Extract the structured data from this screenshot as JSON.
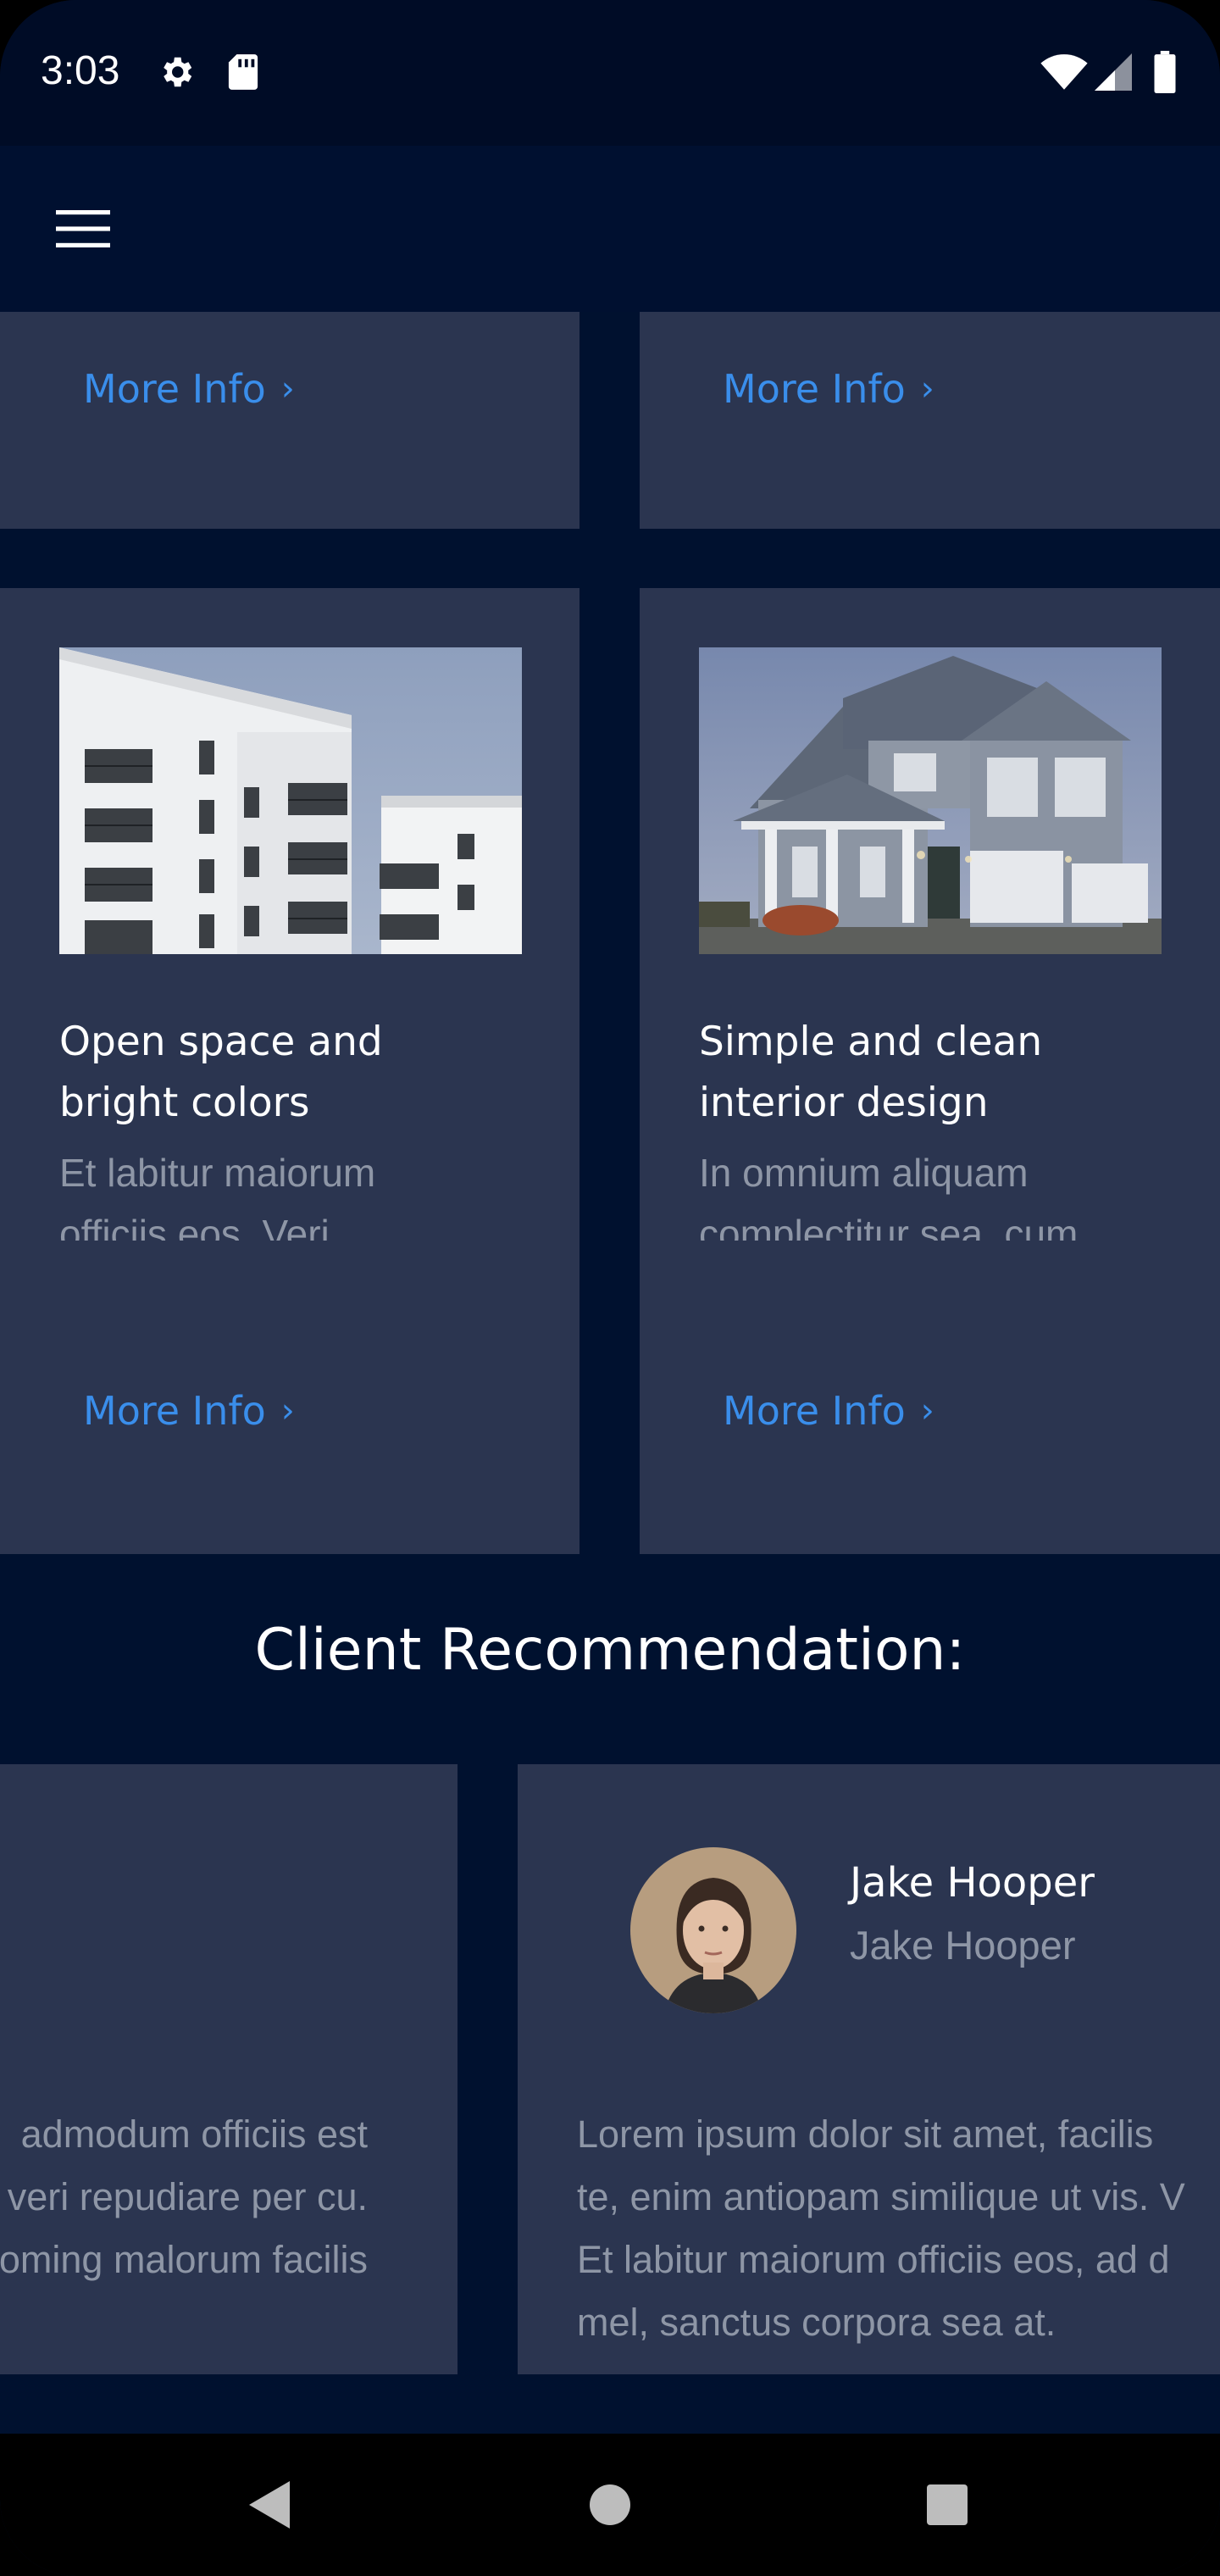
{
  "status_bar": {
    "time": "3:03",
    "icons": [
      "settings-icon",
      "sd-card-icon",
      "wifi-icon",
      "cellular-signal-icon",
      "battery-icon"
    ]
  },
  "toolbar": {
    "menu_icon": "hamburger-menu-icon"
  },
  "colors": {
    "background": "#00112f",
    "card": "#2b3550",
    "link": "#3a8eeb",
    "muted_text": "#8e96a6",
    "status_bar": "#000c26"
  },
  "property_cards_top": [
    {
      "link": "More Info"
    },
    {
      "link": "More Info"
    }
  ],
  "property_cards": [
    {
      "title_line1": "Open space and",
      "title_line2": "bright colors",
      "text_line1": "Et labitur maiorum",
      "text_line2": "officiis eos. Veri",
      "link": "More Info"
    },
    {
      "title_line1": "Simple and clean",
      "title_line2": "interior design",
      "text_line1": "In omnium aliquam",
      "text_line2": "complectitur sea, cum",
      "link": "More Info"
    }
  ],
  "recommendations": {
    "title": "Client Recommendation:",
    "cards": [
      {
        "lines": [
          "admodum officiis est",
          "veri repudiare per cu.",
          "oming malorum facilis"
        ]
      },
      {
        "name": "Jake Hooper",
        "role": "Jake Hooper",
        "lines": [
          "Lorem ipsum dolor sit amet, facilis",
          "te, enim antiopam similique ut vis. V",
          "Et labitur maiorum officiis eos, ad d",
          "mel, sanctus corpora sea at."
        ]
      }
    ]
  },
  "nav_bar": {
    "icons": [
      "back-icon",
      "home-icon",
      "recents-icon"
    ]
  }
}
